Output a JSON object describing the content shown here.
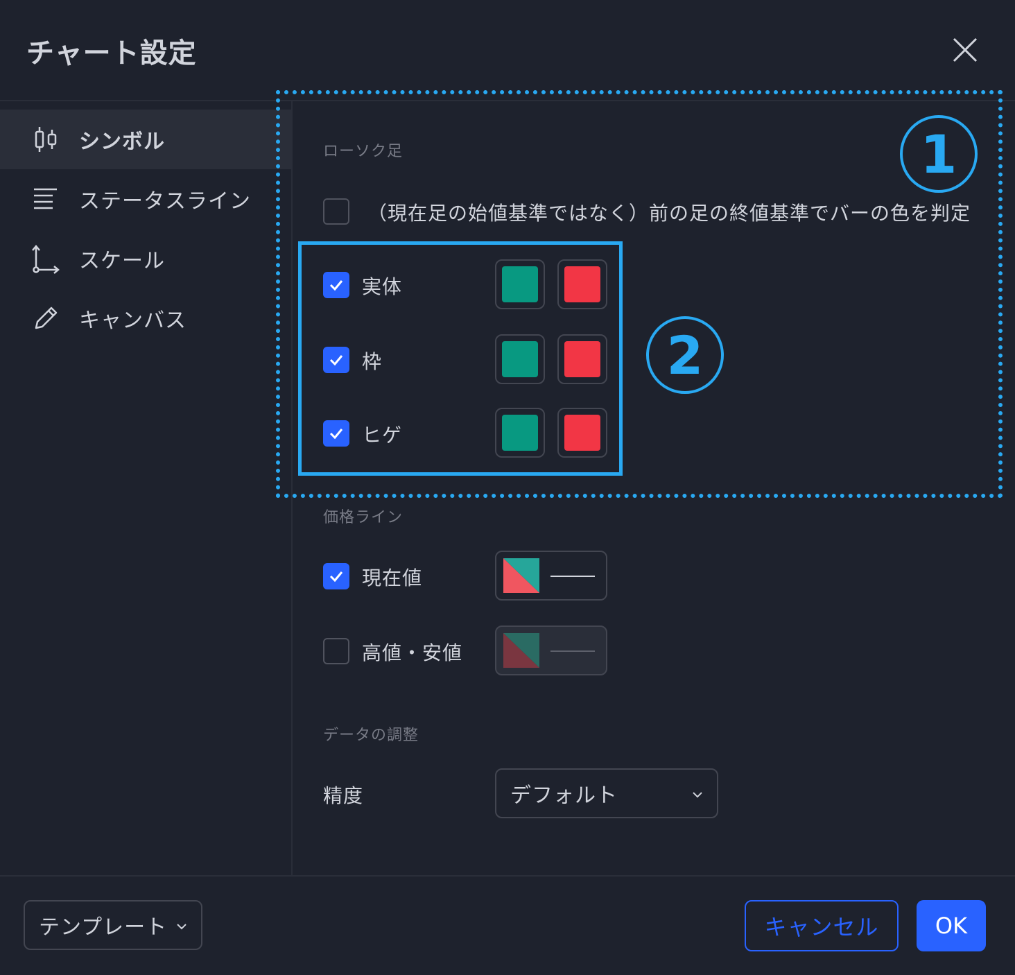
{
  "dialog": {
    "title": "チャート設定"
  },
  "sidebar": {
    "items": [
      {
        "label": "シンボル",
        "icon": "candlestick-icon",
        "active": true
      },
      {
        "label": "ステータスライン",
        "icon": "status-line-icon",
        "active": false
      },
      {
        "label": "スケール",
        "icon": "scale-icon",
        "active": false
      },
      {
        "label": "キャンバス",
        "icon": "pencil-icon",
        "active": false
      }
    ]
  },
  "candles": {
    "section_label": "ローソク足",
    "prev_close_label": "（現在足の始値基準ではなく）前の足の終値基準でバーの色を判定",
    "prev_close_checked": false,
    "rows": [
      {
        "label": "実体",
        "checked": true,
        "up_color": "#089981",
        "down_color": "#f23645"
      },
      {
        "label": "枠",
        "checked": true,
        "up_color": "#089981",
        "down_color": "#f23645"
      },
      {
        "label": "ヒゲ",
        "checked": true,
        "up_color": "#089981",
        "down_color": "#f23645"
      }
    ]
  },
  "price_line": {
    "section_label": "価格ライン",
    "rows": [
      {
        "label": "現在値",
        "checked": true
      },
      {
        "label": "高値・安値",
        "checked": false
      }
    ]
  },
  "data_adjust": {
    "section_label": "データの調整",
    "precision_label": "精度",
    "precision_value": "デフォルト"
  },
  "footer": {
    "template_label": "テンプレート",
    "cancel_label": "キャンセル",
    "ok_label": "OK"
  },
  "annotations": {
    "marker_1": "①",
    "marker_2": "②",
    "color": "#29a9f2"
  },
  "colors": {
    "accent": "#2962ff",
    "up": "#089981",
    "down": "#f23645"
  }
}
